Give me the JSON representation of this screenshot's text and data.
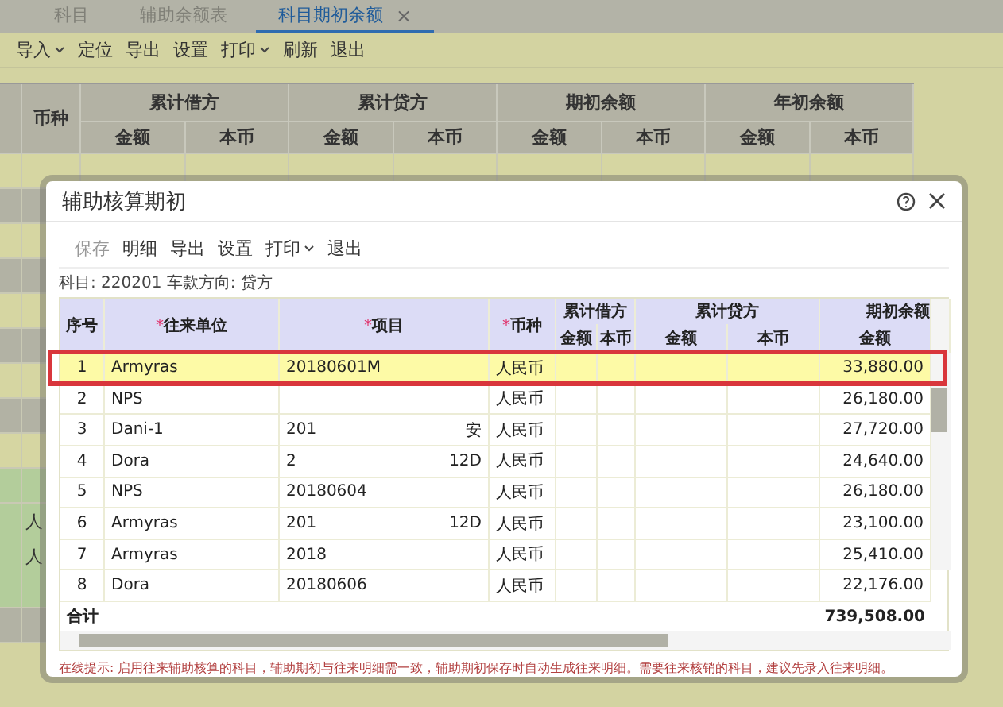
{
  "tabs": [
    {
      "label": "科目",
      "selected": false
    },
    {
      "label": "辅助余额表",
      "selected": false
    },
    {
      "label": "科目期初余额",
      "selected": true,
      "close": "×"
    }
  ],
  "toolbar": [
    {
      "label": "导入",
      "dropdown": true
    },
    {
      "label": "定位",
      "dropdown": false
    },
    {
      "label": "导出",
      "dropdown": false
    },
    {
      "label": "设置",
      "dropdown": false
    },
    {
      "label": "打印",
      "dropdown": true
    },
    {
      "label": "刷新",
      "dropdown": false
    },
    {
      "label": "退出",
      "dropdown": false
    }
  ],
  "sheet": {
    "currency_header": "币种",
    "groups": [
      {
        "title": "累计借方",
        "columns": [
          "金额",
          "本币"
        ]
      },
      {
        "title": "累计贷方",
        "columns": [
          "金额",
          "本币"
        ]
      },
      {
        "title": "期初余额",
        "columns": [
          "金额",
          "本币"
        ]
      },
      {
        "title": "年初余额",
        "columns": [
          "金额",
          "本币"
        ]
      }
    ],
    "rows": [
      {
        "color": "#d6d6a2"
      },
      {
        "color": "#b2b2a4"
      },
      {
        "color": "#d6d6a2"
      },
      {
        "color": "#b2b2a4"
      },
      {
        "color": "#d6d6a2"
      },
      {
        "color": "#b2b2a4"
      },
      {
        "color": "#d6d6a2"
      },
      {
        "color": "#b2b2a4"
      },
      {
        "color": "#d6d6a2"
      },
      {
        "color": "#b3cd9b"
      },
      {
        "color": "#b3cd9b",
        "currency": "人"
      },
      {
        "color": "#b3cd9b",
        "currency": "人"
      },
      {
        "color": "#b3cd9b"
      },
      {
        "color": "#b2b2a4"
      }
    ]
  },
  "dialog": {
    "title": "辅助核算期初",
    "toolbar": [
      {
        "label": "保存",
        "disabled": true,
        "dropdown": false
      },
      {
        "label": "明细",
        "disabled": false,
        "dropdown": false
      },
      {
        "label": "导出",
        "disabled": false,
        "dropdown": false
      },
      {
        "label": "设置",
        "disabled": false,
        "dropdown": false
      },
      {
        "label": "打印",
        "disabled": false,
        "dropdown": true
      },
      {
        "label": "退出",
        "disabled": false,
        "dropdown": false
      }
    ],
    "subject": "科目: 220201 车款方向: 贷方",
    "columns": [
      {
        "label": "序号"
      },
      {
        "mark": "*",
        "label": "往来单位"
      },
      {
        "mark": "*",
        "label": "项目"
      },
      {
        "mark": "*",
        "label": "币种"
      }
    ],
    "groups": [
      {
        "title": "累计借方",
        "columns": [
          "金额",
          "本币"
        ]
      },
      {
        "title": "累计贷方",
        "columns": [
          "金额",
          "本币"
        ]
      },
      {
        "title": "期初余额",
        "columns": [
          "金额"
        ]
      }
    ],
    "rows": [
      {
        "no": "1",
        "unit": "Armyras",
        "project": "20180601M",
        "project_tail": "",
        "currency": "人民币",
        "balance": "33,880.00",
        "selected": true,
        "highlighted": true
      },
      {
        "no": "2",
        "unit": "NPS",
        "project": "",
        "project_tail": "",
        "currency": "人民币",
        "balance": "26,180.00",
        "selected": false,
        "highlighted": false
      },
      {
        "no": "3",
        "unit": "Dani-1",
        "project": "201",
        "project_tail": "安",
        "currency": "人民币",
        "balance": "27,720.00",
        "selected": false,
        "highlighted": false
      },
      {
        "no": "4",
        "unit": "Dora",
        "project": "2",
        "project_tail": "12D",
        "currency": "人民币",
        "balance": "24,640.00",
        "selected": false,
        "highlighted": false
      },
      {
        "no": "5",
        "unit": "NPS",
        "project": "20180604",
        "project_tail": "",
        "currency": "人民币",
        "balance": "26,180.00",
        "selected": false,
        "highlighted": false
      },
      {
        "no": "6",
        "unit": "Armyras",
        "project": "201",
        "project_tail": "12D",
        "currency": "人民币",
        "balance": "23,100.00",
        "selected": false,
        "highlighted": false
      },
      {
        "no": "7",
        "unit": "Armyras",
        "project": "2018",
        "project_tail": "",
        "currency": "人民币",
        "balance": "25,410.00",
        "selected": false,
        "highlighted": false
      },
      {
        "no": "8",
        "unit": "Dora",
        "project": "20180606",
        "project_tail": "",
        "currency": "人民币",
        "balance": "22,176.00",
        "selected": false,
        "highlighted": false
      }
    ],
    "total": {
      "label": "合计",
      "balance": "739,508.00"
    },
    "hint": "在线提示: 启用往来辅助核算的科目，辅助期初与往来明细需一致，辅助期初保存时自动生成往来明细。需要往来核销的科目，建议先录入往来明细。"
  }
}
